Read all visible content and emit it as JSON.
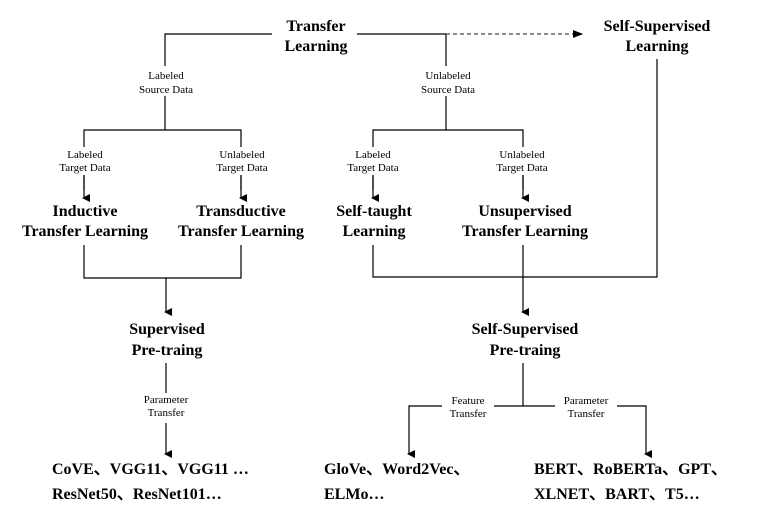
{
  "nodes": {
    "transfer_learning": [
      "Transfer",
      "Learning"
    ],
    "self_supervised_learning": [
      "Self-Supervised",
      "Learning"
    ],
    "inductive": [
      "Inductive",
      "Transfer Learning"
    ],
    "transductive": [
      "Transductive",
      "Transfer Learning"
    ],
    "self_taught": [
      "Self-taught",
      "Learning"
    ],
    "unsupervised_tl": [
      "Unsupervised",
      "Transfer Learning"
    ],
    "supervised_pretraining": [
      "Supervised",
      "Pre-traing"
    ],
    "self_supervised_pretraining": [
      "Self-Supervised",
      "Pre-traing"
    ]
  },
  "edge_labels": {
    "labeled_source": [
      "Labeled",
      "Source Data"
    ],
    "unlabeled_source": [
      "Unlabeled",
      "Source Data"
    ],
    "labeled_target_left": [
      "Labeled",
      "Target Data"
    ],
    "unlabeled_target_left": [
      "Unlabeled",
      "Target Data"
    ],
    "labeled_target_right": [
      "Labeled",
      "Target Data"
    ],
    "unlabeled_target_right": [
      "Unlabeled",
      "Target Data"
    ],
    "parameter_transfer_left": [
      "Parameter",
      "Transfer"
    ],
    "feature_transfer": [
      "Feature",
      "Transfer"
    ],
    "parameter_transfer_right": [
      "Parameter",
      "Transfer"
    ]
  },
  "examples": {
    "supervised": [
      "CoVE、VGG11、VGG11 …",
      "ResNet50、ResNet101…"
    ],
    "feature": [
      "GloVe、Word2Vec、",
      "ELMo…"
    ],
    "parameter": [
      "BERT、RoBERTa、GPT、",
      "XLNET、BART、T5…"
    ]
  }
}
